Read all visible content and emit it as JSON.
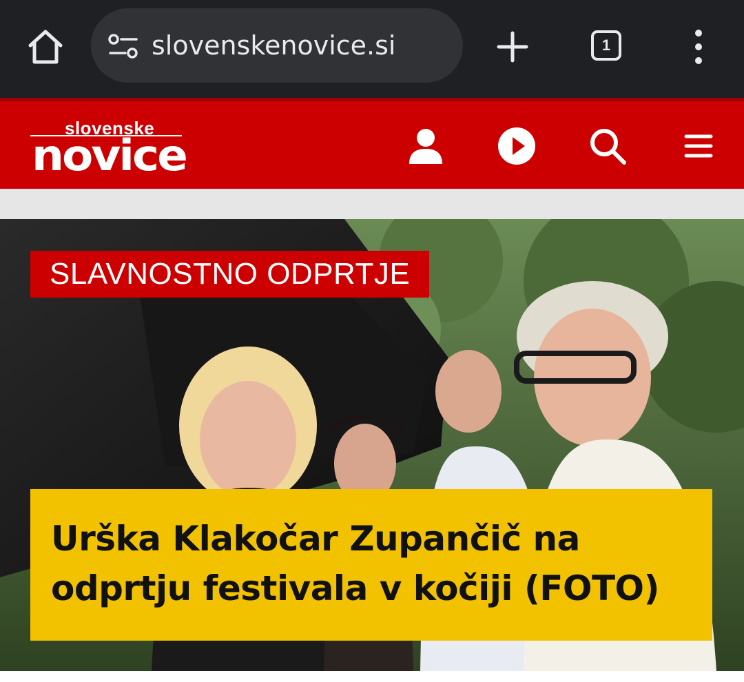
{
  "browser": {
    "url": "slovenskenovice.si",
    "tab_count": "1",
    "icons": [
      "home-icon",
      "site-info-icon",
      "new-tab-plus-icon",
      "tab-switcher-icon",
      "overflow-menu-icon"
    ]
  },
  "site": {
    "logo_small": "slovenske",
    "logo_big": "novice",
    "brand_color": "#cc0000",
    "icons": [
      "user-icon",
      "play-icon",
      "search-icon",
      "hamburger-menu-icon"
    ]
  },
  "article": {
    "kicker": "SLAVNOSTNO ODPRTJE",
    "headline": "Urška Klakočar Zupančič na odprtju festivala v kočiji (FOTO)",
    "kicker_color": "#cc0000",
    "headline_bg": "#f2c200"
  }
}
